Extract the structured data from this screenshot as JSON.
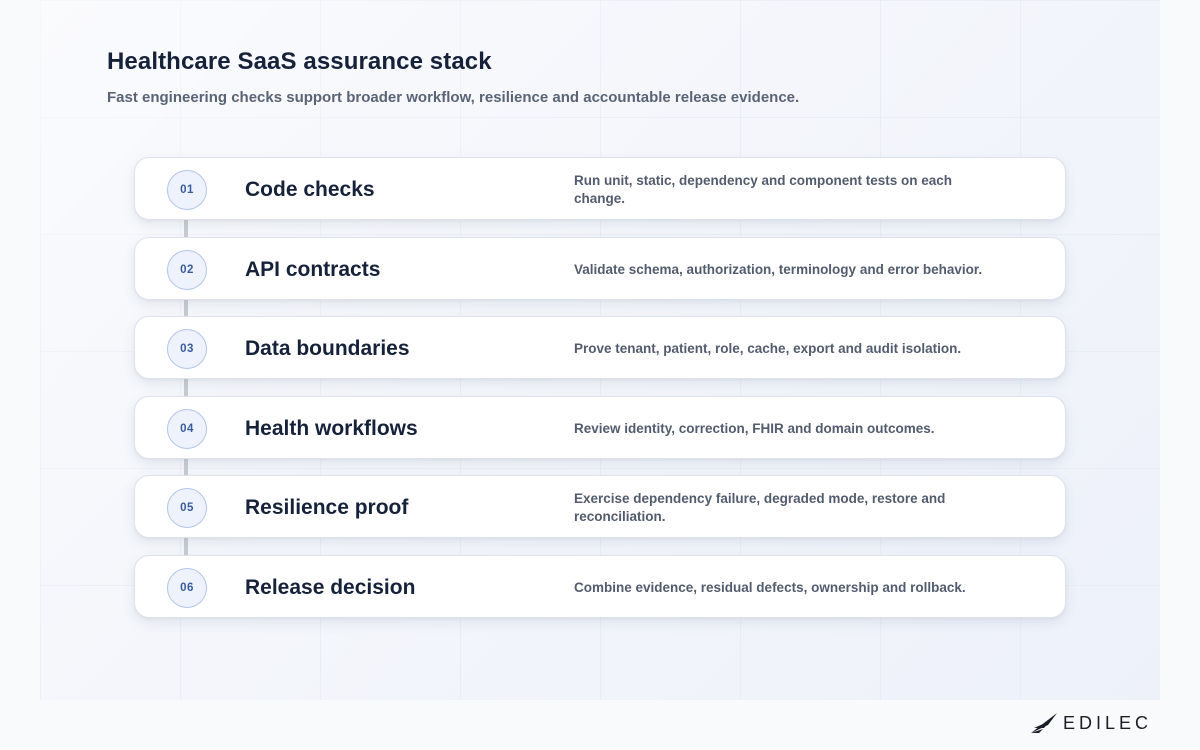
{
  "header": {
    "title": "Healthcare SaaS assurance stack",
    "subtitle": "Fast engineering checks support broader workflow, resilience and accountable release evidence."
  },
  "steps": [
    {
      "number": "01",
      "title": "Code checks",
      "description": "Run unit, static, dependency and component tests on each change."
    },
    {
      "number": "02",
      "title": "API contracts",
      "description": "Validate schema, authorization, terminology and error behavior."
    },
    {
      "number": "03",
      "title": "Data boundaries",
      "description": "Prove tenant, patient, role, cache, export and audit isolation."
    },
    {
      "number": "04",
      "title": "Health workflows",
      "description": "Review identity, correction, FHIR and domain outcomes."
    },
    {
      "number": "05",
      "title": "Resilience proof",
      "description": "Exercise dependency failure, degraded mode, restore and reconciliation."
    },
    {
      "number": "06",
      "title": "Release decision",
      "description": "Combine evidence, residual defects, ownership and rollback."
    }
  ],
  "footer": {
    "logo_text": "EDILEC"
  },
  "colors": {
    "title": "#16213a",
    "badge_border": "#b3c5ea",
    "badge_text": "#3a5c9c"
  },
  "icons": {
    "logo": "bird-wing-icon"
  }
}
